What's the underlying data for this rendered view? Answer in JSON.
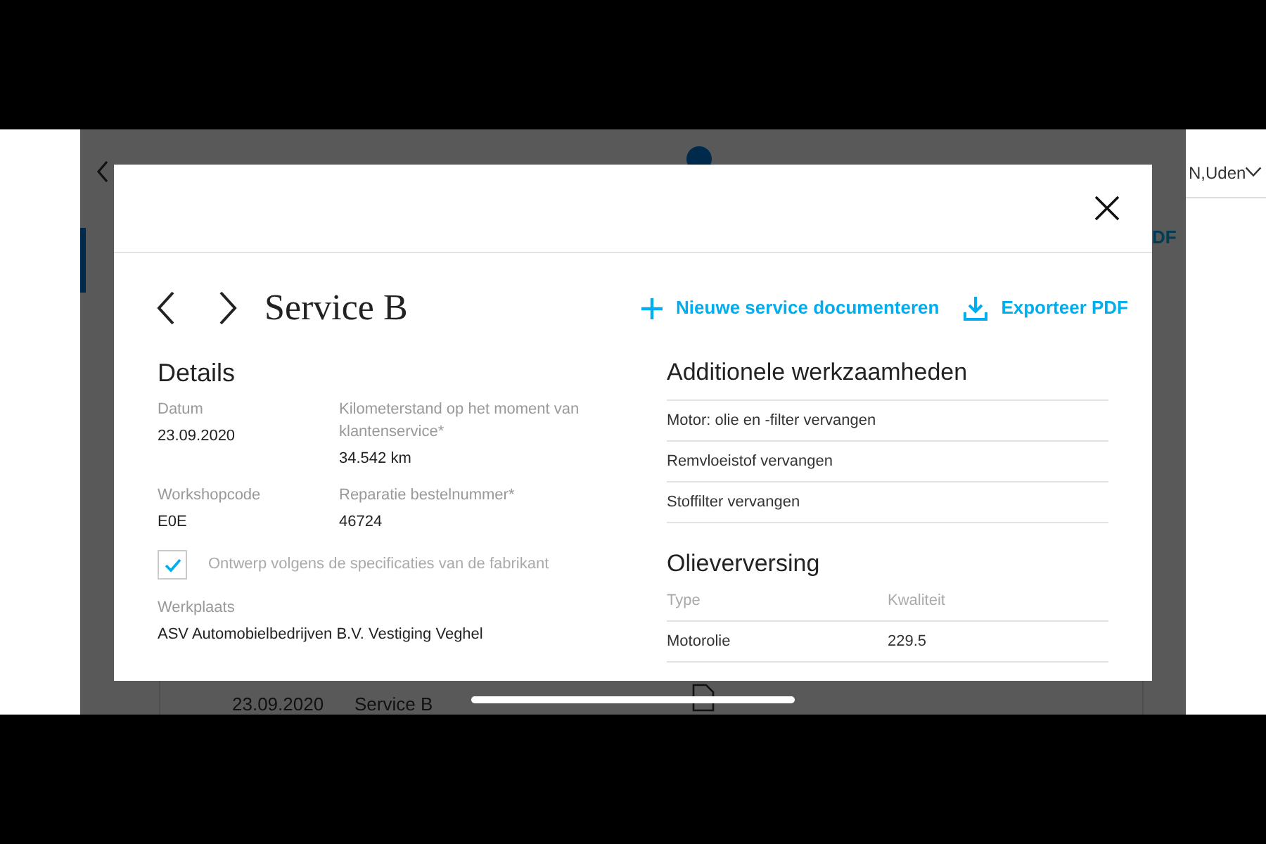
{
  "background": {
    "location": "N,Uden",
    "export_link": "DF",
    "row": {
      "date": "23.09.2020",
      "service": "Service B"
    }
  },
  "modal": {
    "title": "Service B",
    "actions": [
      {
        "kind": "add",
        "label": "Nieuwe service documenteren"
      },
      {
        "kind": "download",
        "label": "Exporteer PDF"
      }
    ],
    "details": {
      "heading": "Details",
      "fields": [
        {
          "label": "Datum",
          "value": "23.09.2020"
        },
        {
          "label": "Kilometerstand op het moment van klantenservice*",
          "value": "34.542 km"
        },
        {
          "label": "Workshopcode",
          "value": "E0E"
        },
        {
          "label": "Reparatie bestelnummer*",
          "value": "46724"
        }
      ],
      "checkbox": {
        "label": "Ontwerp volgens de specificaties van de fabrikant",
        "checked": true
      },
      "workshop": {
        "label": "Werkplaats",
        "value": "ASV Automobielbedrijven B.V. Vestiging Veghel"
      }
    },
    "additional_work": {
      "heading": "Additionele werkzaamheden",
      "items": [
        "Motor: olie en -filter vervangen",
        "Remvloeistof vervangen",
        "Stoffilter vervangen"
      ]
    },
    "oil_change": {
      "heading": "Olieverversing",
      "columns": [
        "Type",
        "Kwaliteit"
      ],
      "rows": [
        [
          "Motorolie",
          "229.5"
        ]
      ]
    }
  }
}
